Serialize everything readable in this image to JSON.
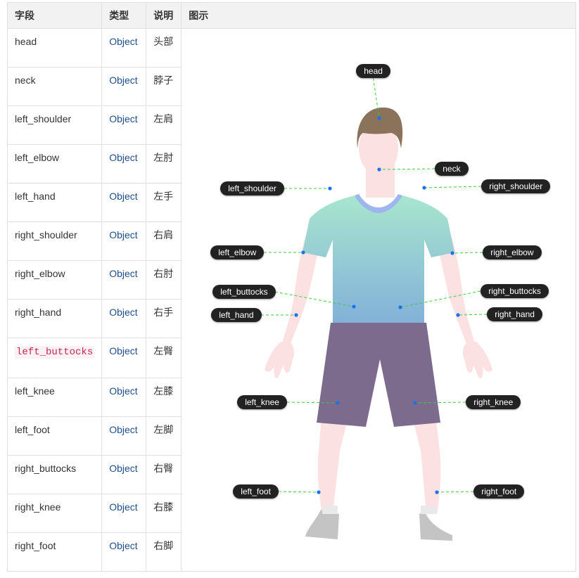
{
  "headers": {
    "field": "字段",
    "type": "类型",
    "desc": "说明",
    "figure": "图示"
  },
  "rows": [
    {
      "field": "head",
      "type": "Object",
      "desc": "头部"
    },
    {
      "field": "neck",
      "type": "Object",
      "desc": "脖子"
    },
    {
      "field": "left_shoulder",
      "type": "Object",
      "desc": "左肩"
    },
    {
      "field": "left_elbow",
      "type": "Object",
      "desc": "左肘"
    },
    {
      "field": "left_hand",
      "type": "Object",
      "desc": "左手"
    },
    {
      "field": "right_shoulder",
      "type": "Object",
      "desc": "右肩"
    },
    {
      "field": "right_elbow",
      "type": "Object",
      "desc": "右肘"
    },
    {
      "field": "right_hand",
      "type": "Object",
      "desc": "右手"
    },
    {
      "field": "left_buttocks",
      "type": "Object",
      "desc": "左臀"
    },
    {
      "field": "left_knee",
      "type": "Object",
      "desc": "左膝"
    },
    {
      "field": "left_foot",
      "type": "Object",
      "desc": "左脚"
    },
    {
      "field": "right_buttocks",
      "type": "Object",
      "desc": "右臀"
    },
    {
      "field": "right_knee",
      "type": "Object",
      "desc": "右膝"
    },
    {
      "field": "right_foot",
      "type": "Object",
      "desc": "右脚"
    }
  ],
  "labels": {
    "head": "head",
    "neck": "neck",
    "left_shoulder": "left_shoulder",
    "right_shoulder": "right_shoulder",
    "left_elbow": "left_elbow",
    "right_elbow": "right_elbow",
    "left_buttocks": "left_buttocks",
    "right_buttocks": "right_buttocks",
    "left_hand": "left_hand",
    "right_hand": "right_hand",
    "left_knee": "left_knee",
    "right_knee": "right_knee",
    "left_foot": "left_foot",
    "right_foot": "right_foot"
  },
  "colors": {
    "keypoint": "#1a73e8",
    "leader_line": "#3ccf3c",
    "shirt_top": "#a8e6cf",
    "shirt_bottom": "#82b0d8",
    "shorts": "#7d6b8d",
    "skin": "#fce1e3",
    "hair": "#8b735b"
  }
}
